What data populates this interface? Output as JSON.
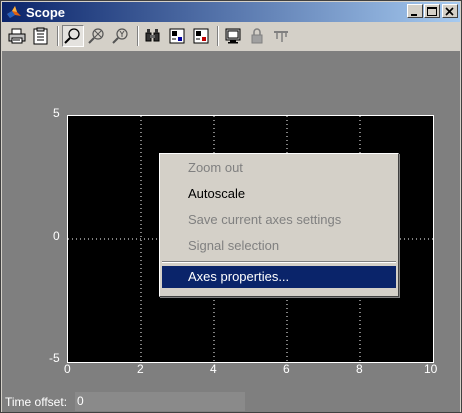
{
  "window": {
    "title": "Scope"
  },
  "toolbar": {
    "icons": [
      "print-icon",
      "parameters-icon",
      "zoom-icon",
      "zoom-x-icon",
      "zoom-y-icon",
      "autoscale-icon",
      "save-axes-icon",
      "restore-axes-icon",
      "floating-scope-icon",
      "lock-axes-icon",
      "signal-selector-icon"
    ]
  },
  "axes": {
    "y_ticks": [
      "5",
      "0",
      "-5"
    ],
    "x_ticks": [
      "0",
      "2",
      "4",
      "6",
      "8",
      "10"
    ],
    "ylim": [
      -5,
      5
    ],
    "xlim": [
      0,
      10
    ]
  },
  "status": {
    "label": "Time offset:",
    "value": "0"
  },
  "context_menu": {
    "items": [
      {
        "label": "Zoom out",
        "enabled": false
      },
      {
        "label": "Autoscale",
        "enabled": true
      },
      {
        "label": "Save current axes settings",
        "enabled": false
      },
      {
        "label": "Signal selection",
        "enabled": false
      },
      {
        "label": "Axes properties...",
        "enabled": true,
        "selected": true
      }
    ]
  },
  "colors": {
    "titlebar_start": "#0a246a",
    "titlebar_end": "#a6caf0",
    "figure_bg": "#7f7f7f",
    "axes_bg": "#000000",
    "menu_highlight": "#0a246a"
  }
}
